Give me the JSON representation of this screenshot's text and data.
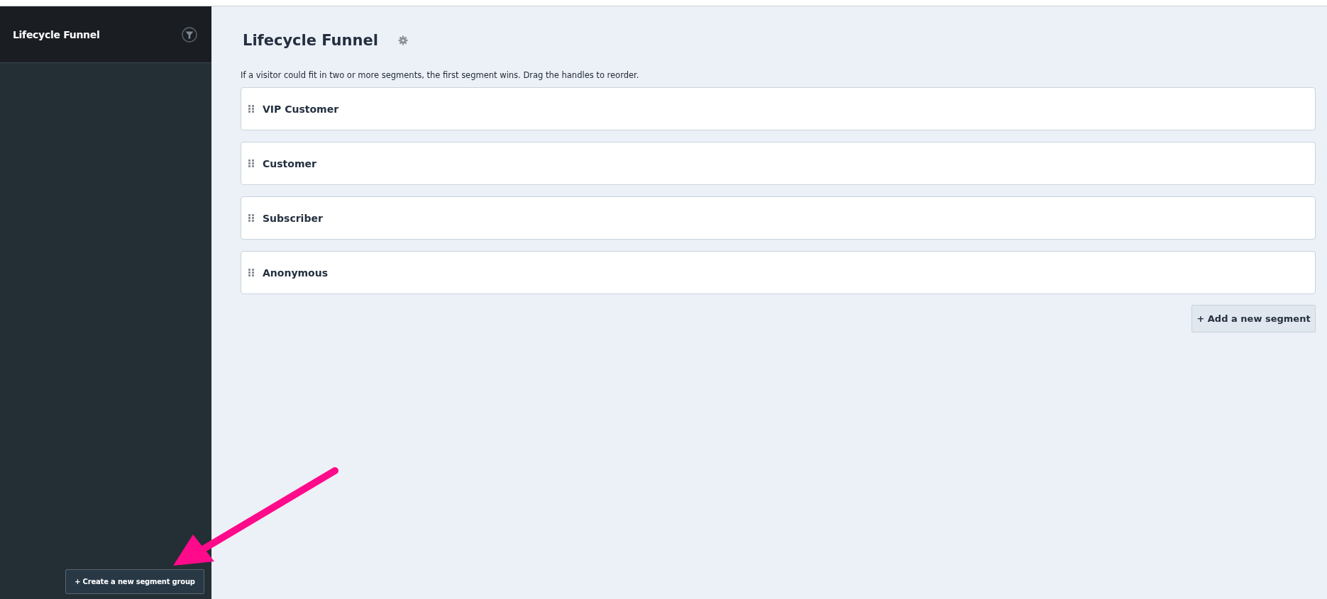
{
  "sidebar": {
    "title": "Lifecycle Funnel",
    "create_button": "+ Create a new segment group"
  },
  "main": {
    "title": "Lifecycle Funnel",
    "description": "If a visitor could fit in two or more segments, the first segment wins. Drag the handles to reorder.",
    "segments": [
      {
        "name": "VIP Customer"
      },
      {
        "name": "Customer"
      },
      {
        "name": "Subscriber"
      },
      {
        "name": "Anonymous"
      }
    ],
    "add_button": "+ Add a new segment"
  }
}
